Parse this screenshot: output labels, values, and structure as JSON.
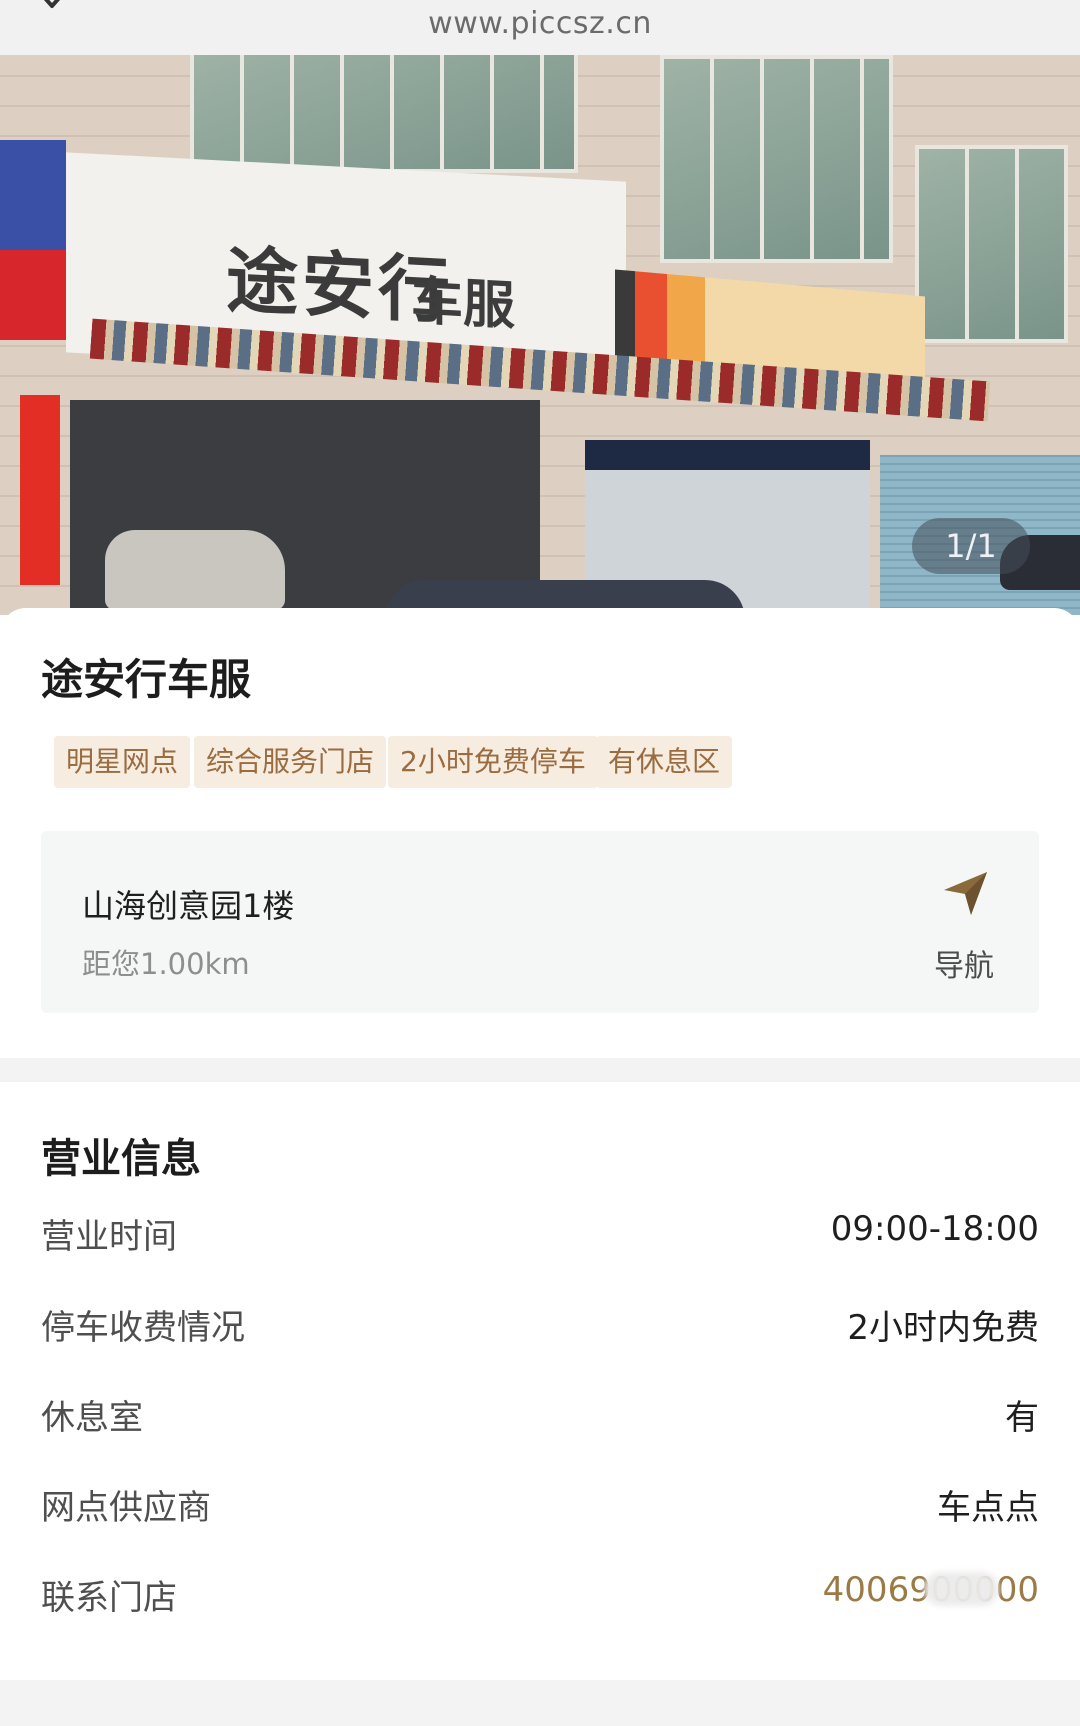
{
  "browser": {
    "url": "www.piccsz.cn"
  },
  "photo": {
    "sign_brand": "途安行",
    "sign_brand_suffix": "车服",
    "counter": "1/1"
  },
  "shop": {
    "name": "途安行车服",
    "tags": [
      "明星网点",
      "综合服务门店",
      "2小时免费停车",
      "有休息区"
    ],
    "address": "山海创意园1楼",
    "distance": "距您1.00km",
    "nav_label": "导航"
  },
  "business": {
    "title": "营业信息",
    "rows": [
      {
        "label": "营业时间",
        "value": "09:00-18:00"
      },
      {
        "label": "停车收费情况",
        "value": "2小时内免费"
      },
      {
        "label": "休息室",
        "value": "有"
      },
      {
        "label": "网点供应商",
        "value": "车点点"
      },
      {
        "label": "联系门店",
        "value": "4006900000"
      }
    ]
  },
  "colors": {
    "tag_bg": "#f6ece0",
    "tag_text": "#9a6c3f",
    "nav_icon": "#8a6a3b",
    "phone": "#9a7a45"
  },
  "icons": {
    "close": "close-icon",
    "navigate": "navigation-arrow-icon"
  }
}
